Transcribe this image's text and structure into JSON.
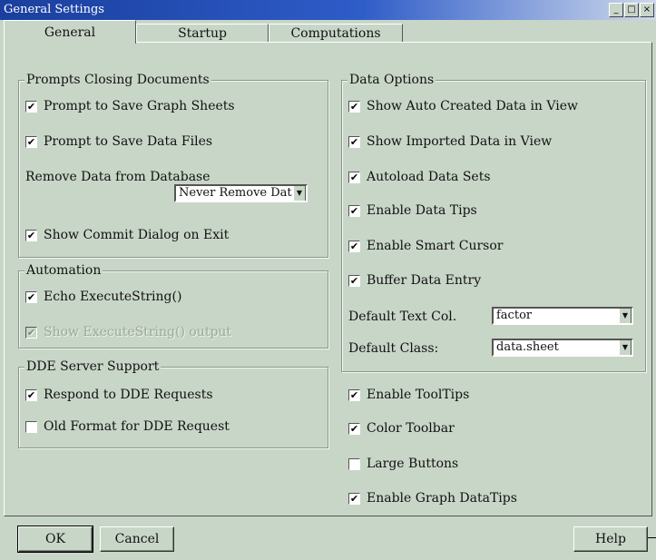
{
  "window": {
    "title": "General Settings",
    "controls": {
      "minimize": "_",
      "maximize": "□",
      "close": "×"
    }
  },
  "tabs": [
    {
      "label": "General",
      "active": true
    },
    {
      "label": "Startup",
      "active": false
    },
    {
      "label": "Computations",
      "active": false
    }
  ],
  "prompts": {
    "legend": "Prompts Closing Documents",
    "save_graph": "Prompt to Save Graph Sheets",
    "save_data": "Prompt to Save Data Files",
    "remove_label": "Remove Data from Database",
    "remove_value": "Never Remove Dat",
    "commit": "Show Commit Dialog on Exit"
  },
  "automation": {
    "legend": "Automation",
    "echo": "Echo ExecuteString()",
    "show_output": "Show ExecuteString() output"
  },
  "dde": {
    "legend": "DDE Server Support",
    "respond": "Respond to DDE Requests",
    "old_format": "Old Format for DDE Request"
  },
  "data_options": {
    "legend": "Data Options",
    "auto_created": "Show Auto Created Data in View",
    "imported": "Show Imported Data in View",
    "autoload": "Autoload Data Sets",
    "datatips": "Enable Data Tips",
    "smart_cursor": "Enable Smart Cursor",
    "buffer": "Buffer Data Entry",
    "text_col_label": "Default Text Col.",
    "text_col_value": "factor",
    "class_label": "Default Class:",
    "class_value": "data.sheet"
  },
  "ui_options": {
    "tooltips": "Enable ToolTips",
    "color_toolbar": "Color Toolbar",
    "large_buttons": "Large Buttons",
    "graph_datatips": "Enable Graph DataTips"
  },
  "checks": {
    "mark": "✔"
  },
  "buttons": {
    "ok": "OK",
    "cancel": "Cancel",
    "help": "Help"
  }
}
